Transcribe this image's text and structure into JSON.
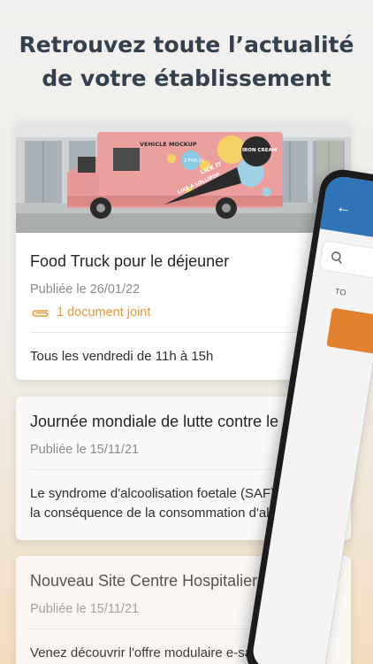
{
  "header": {
    "line1": "Retrouvez toute l’actualité",
    "line2": "de votre établissement"
  },
  "cards": [
    {
      "title": "Food Truck pour le déjeuner",
      "date": "Publiée le 26/01/22",
      "attachment": "1 document joint",
      "description": "Tous les vendredi de 11h à 15h",
      "image_text": {
        "vehicle": "VEHICLE MOCKUP",
        "badge": "2 FOR $5",
        "brand": "IRON CREAM",
        "slogan1": "LICK IT",
        "slogan2": "LIKE A LOLLIPOP"
      }
    },
    {
      "title": "Journée mondiale de lutte contre le syn...",
      "date": "Publiée le 15/11/21",
      "description_lines": [
        "Le syndrome d'alcoolisation foetale (SAF) est",
        "la conséquence de la consommation d'alcool p..."
      ]
    },
    {
      "title": "Nouveau Site Centre Hospitalier Régio...",
      "date": "Publiée le 15/11/21",
      "description": "Venez découvrir l'offre modulaire e-santé"
    }
  ],
  "phone": {
    "tab_label": "TO"
  },
  "colors": {
    "headline": "#34404e",
    "accent_orange": "#e39a3f",
    "phone_blue": "#2f74b5"
  }
}
